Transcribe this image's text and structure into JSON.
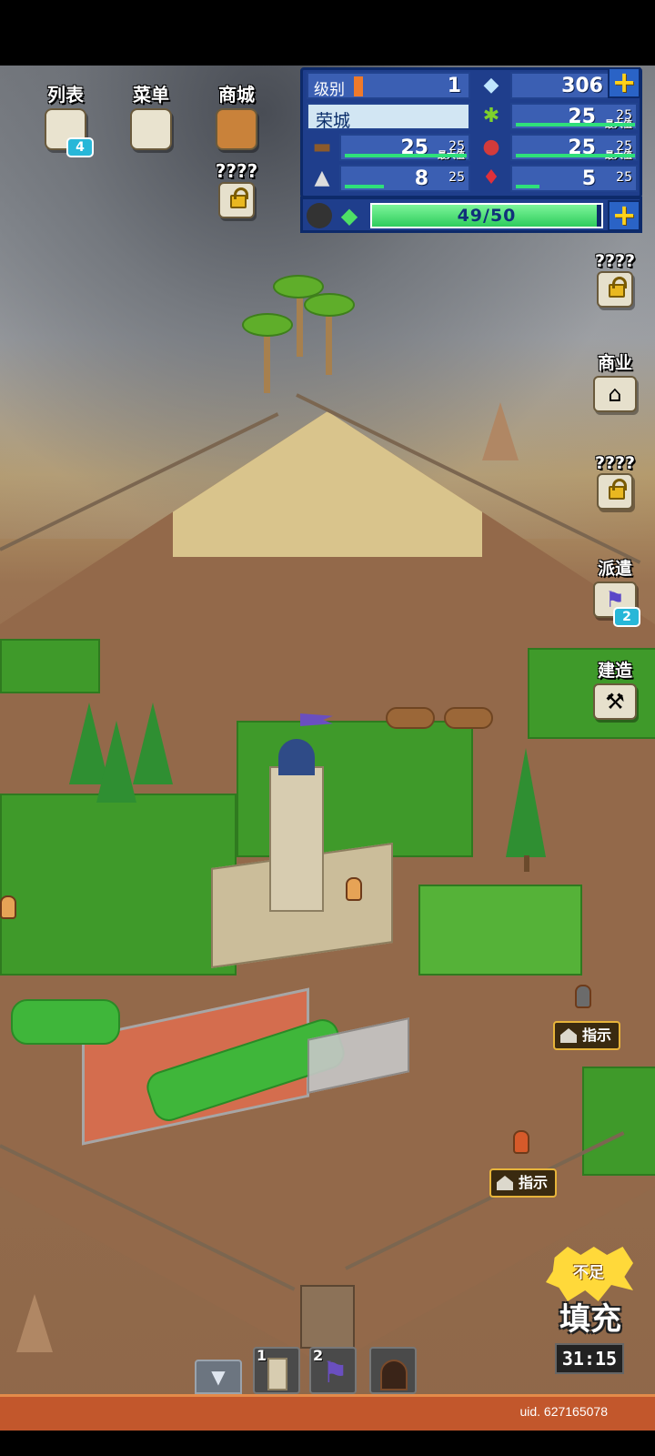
{
  "top_menu": {
    "list_label": "列表",
    "list_badge": "4",
    "menu_label": "菜单",
    "shop_label": "商城",
    "locked_label": "????"
  },
  "resources": {
    "level_label": "级别",
    "level_value": "1",
    "gems": "306",
    "town_name": "荣城",
    "max_tag": "最大值",
    "grass": {
      "value": "25",
      "max": "25",
      "fill": 1.0
    },
    "wood": {
      "value": "25",
      "max": "25",
      "fill": 1.0
    },
    "food": {
      "value": "25",
      "max": "25",
      "fill": 1.0
    },
    "ore": {
      "value": "8",
      "max": "25",
      "fill": 0.32
    },
    "ruby": {
      "value": "5",
      "max": "25",
      "fill": 0.2
    },
    "energy_text": "49/50",
    "energy_fill": 0.98
  },
  "side_menu": {
    "locked1_label": "????",
    "commerce_label": "商业",
    "locked2_label": "????",
    "dispatch_label": "派遣",
    "dispatch_badge": "2",
    "build_label": "建造"
  },
  "hints": {
    "label1": "指示",
    "label2": "指示"
  },
  "refill": {
    "badge": "不足",
    "title": "填充",
    "timer": "31:15"
  },
  "hotbar": {
    "slot1_num": "1",
    "slot2_num": "2"
  },
  "footer": {
    "uid": "uid. 627165078"
  },
  "colors": {
    "accent_gold": "#ffd21a",
    "energy_green": "#2ecc5c",
    "panel_blue": "#1f3e8c"
  }
}
